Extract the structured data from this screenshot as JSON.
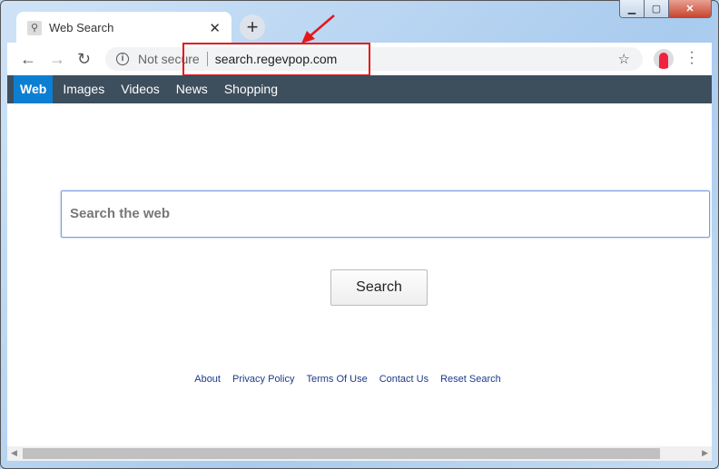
{
  "window": {
    "minimize": "▁",
    "maximize": "▢",
    "close": "✕"
  },
  "tab": {
    "title": "Web Search",
    "favicon": "search-icon",
    "close": "✕",
    "new_tab": "+"
  },
  "toolbar": {
    "back": "←",
    "forward": "→",
    "reload": "↻",
    "security_label": "Not secure",
    "url": "search.regevpop.com",
    "bookmark": "☆",
    "menu": "⋮"
  },
  "nav": {
    "items": [
      "Web",
      "Images",
      "Videos",
      "News",
      "Shopping"
    ],
    "active": "Web"
  },
  "search": {
    "placeholder": "Search the web",
    "button": "Search"
  },
  "footer": {
    "links": [
      "About",
      "Privacy Policy",
      "Terms Of Use",
      "Contact Us",
      "Reset Search"
    ]
  },
  "colors": {
    "nav_bg": "#3d4e5d",
    "active_tab": "#0d7fd2",
    "highlight": "#e5171c",
    "link": "#1f3a8a"
  }
}
